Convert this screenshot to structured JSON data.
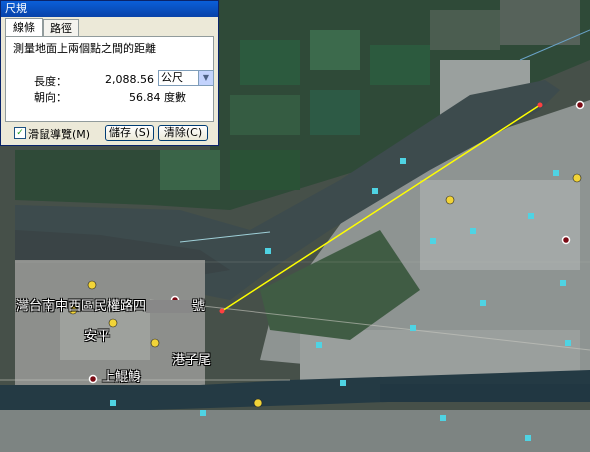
{
  "dialog": {
    "title": "尺規",
    "tabs": [
      "線條",
      "路徑"
    ],
    "description": "測量地面上兩個點之間的距離",
    "length_label": "長度：",
    "length_value": "2,088.56",
    "unit": "公尺",
    "heading_label": "朝向：",
    "heading_value": "56.84 度數",
    "mouse_nav_label": "滑鼠導覽(M)",
    "mouse_nav_checked": true,
    "save_label": "儲存 (S)",
    "clear_label": "清除(C)"
  },
  "map": {
    "labels": {
      "road": "灣台南中西區民權路四",
      "road_suffix": "號",
      "anping": "安平",
      "gangzaiwei": "港子尾",
      "shangkunshen": "上鯤鯓"
    },
    "ruler_color": "#ffff00"
  }
}
